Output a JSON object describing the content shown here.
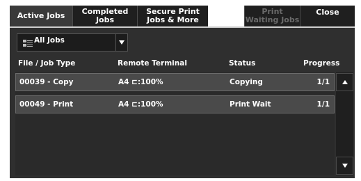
{
  "tabs": {
    "active_jobs": "Active Jobs",
    "completed_jobs": "Completed\nJobs",
    "secure_print": "Secure Print\nJobs & More",
    "print_waiting": "Print\nWaiting Jobs",
    "close": "Close"
  },
  "filter": {
    "label": "All Jobs"
  },
  "columns": {
    "file_job_type": "File / Job Type",
    "remote_terminal": "Remote Terminal",
    "status": "Status",
    "progress": "Progress"
  },
  "rows": [
    {
      "file": "00039 - Copy",
      "remote": "A4 ⊏:100%",
      "status": "Copying",
      "progress": "1/1"
    },
    {
      "file": "00049 - Print",
      "remote": "A4 ⊏:100%",
      "status": "Print Wait",
      "progress": "1/1"
    }
  ],
  "icons": {
    "filter": "list-icon",
    "dropdown": "chevron-down-icon",
    "scroll_up": "scroll-up-icon",
    "scroll_down": "scroll-down-icon"
  }
}
